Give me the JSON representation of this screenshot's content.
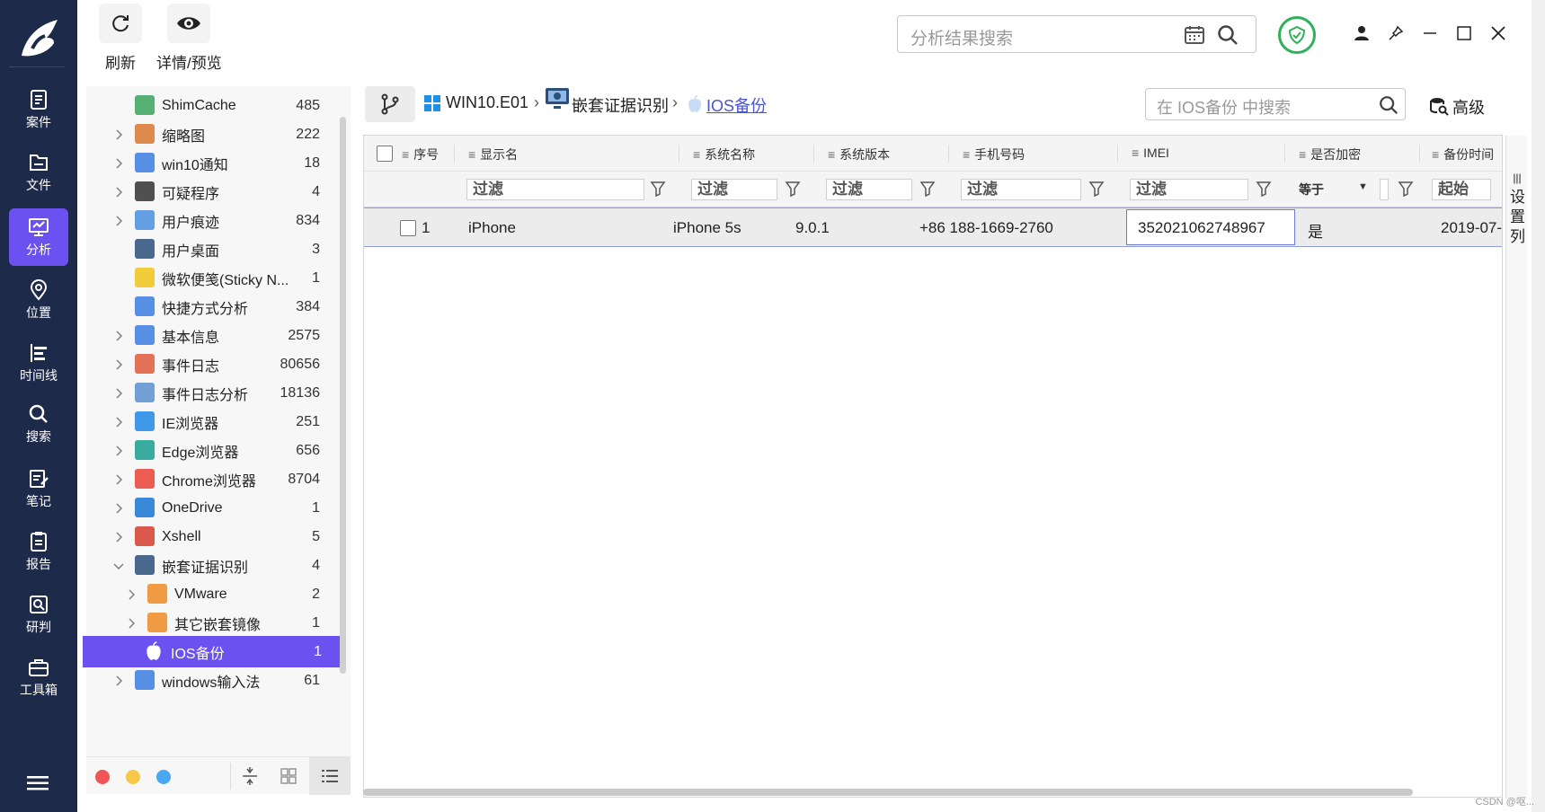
{
  "nav": {
    "items": [
      {
        "label": "案件",
        "icon": "case-icon"
      },
      {
        "label": "文件",
        "icon": "folder-icon"
      },
      {
        "label": "分析",
        "icon": "analysis-icon",
        "active": true
      },
      {
        "label": "位置",
        "icon": "location-icon"
      },
      {
        "label": "时间线",
        "icon": "timeline-icon"
      },
      {
        "label": "搜索",
        "icon": "search-icon"
      },
      {
        "label": "笔记",
        "icon": "note-icon"
      },
      {
        "label": "报告",
        "icon": "report-icon"
      },
      {
        "label": "研判",
        "icon": "judge-icon"
      },
      {
        "label": "工具箱",
        "icon": "toolbox-icon"
      }
    ]
  },
  "toolbar": {
    "refresh_label": "刷新",
    "preview_label": "详情/预览",
    "search_placeholder": "分析结果搜索"
  },
  "tree": {
    "items": [
      {
        "label": "ShimCache",
        "count": "485",
        "icon": "shimcache-icon",
        "expandable": false,
        "indent": 0,
        "color": "#3aa35c"
      },
      {
        "label": "缩略图",
        "count": "222",
        "icon": "thumbnail-icon",
        "expandable": true,
        "indent": 0,
        "color": "#d9762f"
      },
      {
        "label": "win10通知",
        "count": "18",
        "icon": "bell-icon",
        "expandable": true,
        "indent": 0,
        "color": "#3b7de0"
      },
      {
        "label": "可疑程序",
        "count": "4",
        "icon": "suspicious-icon",
        "expandable": true,
        "indent": 0,
        "color": "#333333"
      },
      {
        "label": "用户痕迹",
        "count": "834",
        "icon": "trace-icon",
        "expandable": true,
        "indent": 0,
        "color": "#4a8fe0"
      },
      {
        "label": "用户桌面",
        "count": "3",
        "icon": "desktop-icon",
        "expandable": false,
        "indent": 0,
        "color": "#2c4f7a"
      },
      {
        "label": "微软便笺(Sticky N...",
        "count": "1",
        "icon": "sticky-note-icon",
        "expandable": false,
        "indent": 0,
        "color": "#f0c419"
      },
      {
        "label": "快捷方式分析",
        "count": "384",
        "icon": "shortcut-icon",
        "expandable": false,
        "indent": 0,
        "color": "#3b7de0"
      },
      {
        "label": "基本信息",
        "count": "2575",
        "icon": "info-list-icon",
        "expandable": true,
        "indent": 0,
        "color": "#3b7de0"
      },
      {
        "label": "事件日志",
        "count": "80656",
        "icon": "event-log-icon",
        "expandable": true,
        "indent": 0,
        "color": "#e05a3b"
      },
      {
        "label": "事件日志分析",
        "count": "18136",
        "icon": "event-analysis-icon",
        "expandable": true,
        "indent": 0,
        "color": "#5a8fd0"
      },
      {
        "label": "IE浏览器",
        "count": "251",
        "icon": "ie-icon",
        "expandable": true,
        "indent": 0,
        "color": "#1e88e5"
      },
      {
        "label": "Edge浏览器",
        "count": "656",
        "icon": "edge-icon",
        "expandable": true,
        "indent": 0,
        "color": "#1a9e8f"
      },
      {
        "label": "Chrome浏览器",
        "count": "8704",
        "icon": "chrome-icon",
        "expandable": true,
        "indent": 0,
        "color": "#e94235"
      },
      {
        "label": "OneDrive",
        "count": "1",
        "icon": "cloud-icon",
        "expandable": true,
        "indent": 0,
        "color": "#1976d2"
      },
      {
        "label": "Xshell",
        "count": "5",
        "icon": "xshell-icon",
        "expandable": true,
        "indent": 0,
        "color": "#d63c2f"
      },
      {
        "label": "嵌套证据识别",
        "count": "4",
        "icon": "nested-evidence-icon",
        "expandable": true,
        "expanded": true,
        "indent": 0,
        "color": "#2c4f7a"
      },
      {
        "label": "VMware",
        "count": "2",
        "icon": "vmware-icon",
        "expandable": true,
        "indent": 1,
        "color": "#f08a24"
      },
      {
        "label": "其它嵌套镜像",
        "count": "1",
        "icon": "image-icon",
        "expandable": true,
        "indent": 1,
        "color": "#f08a24"
      },
      {
        "label": "IOS备份",
        "count": "1",
        "icon": "apple-icon",
        "expandable": false,
        "indent": 1,
        "color": "#ffffff",
        "selected": true
      },
      {
        "label": "windows输入法",
        "count": "61",
        "icon": "keyboard-icon",
        "expandable": true,
        "indent": 0,
        "color": "#3b7de0"
      }
    ]
  },
  "breadcrumb": {
    "items": [
      "WIN10.E01",
      "嵌套证据识别",
      "IOS备份"
    ]
  },
  "grid_search_placeholder": "在 IOS备份 中搜索",
  "advanced_label": "高级",
  "grid": {
    "columns": [
      "序号",
      "显示名",
      "系统名称",
      "系统版本",
      "手机号码",
      "IMEI",
      "是否加密",
      "备份时间"
    ],
    "filter_placeholder": "过滤",
    "encrypt_filter": "等于",
    "time_filter": "起始",
    "rows": [
      {
        "index": "1",
        "name": "iPhone",
        "system_name": "iPhone 5s",
        "version": "9.0.1",
        "phone": "+86 188-1669-2760",
        "imei": "352021062748967",
        "encrypted": "是",
        "backup_time": "2019-07-"
      }
    ]
  },
  "column_settings_label": [
    "|||",
    "设",
    "置",
    "列"
  ],
  "watermark": "CSDN @呕..."
}
